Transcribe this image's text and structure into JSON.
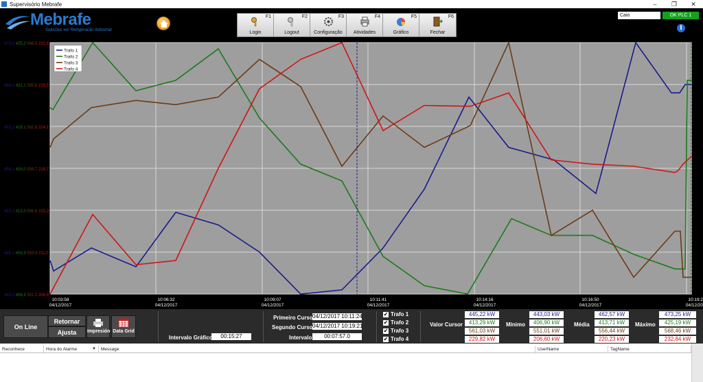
{
  "window": {
    "title": "Supervisório Mebrafe",
    "controls": [
      "–",
      "❐",
      "✕"
    ]
  },
  "logo": {
    "name": "Mebrafe",
    "tagline": "Soluções em Refrigeração Industrial"
  },
  "toolbar": [
    {
      "key": "F1",
      "label": "Login",
      "icon": "key-icon"
    },
    {
      "key": "F2",
      "label": "Logout",
      "icon": "key-out-icon"
    },
    {
      "key": "F3",
      "label": "Configuração",
      "icon": "gear-icon"
    },
    {
      "key": "F4",
      "label": "Atividades",
      "icon": "printer-list-icon"
    },
    {
      "key": "F5",
      "label": "Gráfico",
      "icon": "chart-icon"
    },
    {
      "key": "F6",
      "label": "Fechar",
      "icon": "exit-icon"
    }
  ],
  "user": "Caio",
  "plc_status": "OK PLC 1",
  "colors": {
    "trafo1": "#1a1a8c",
    "trafo2": "#1b7a1b",
    "trafo3": "#6b3a14",
    "trafo4": "#d01414",
    "plot_bg": "#9e9e9e",
    "plc_ok": "#14a21e"
  },
  "chart_data": {
    "type": "line",
    "y_axis_labels": [
      {
        "t1": "473,2",
        "t2": "425,2",
        "t3": "568,5",
        "t4": "232,8"
      },
      {
        "t1": "468,2",
        "t2": "422,1",
        "t3": "565,6",
        "t4": "228,5"
      },
      {
        "t1": "463,2",
        "t2": "419,1",
        "t3": "562,6",
        "t4": "224,1"
      },
      {
        "t1": "458,1",
        "t2": "416,0",
        "t3": "559,7",
        "t4": "219,7"
      },
      {
        "t1": "453,1",
        "t2": "413,0",
        "t3": "556,8",
        "t4": "215,3"
      },
      {
        "t1": "448,1",
        "t2": "409,9",
        "t3": "553,9",
        "t4": "211,0"
      },
      {
        "t1": "443,0",
        "t2": "406,9",
        "t3": "551,0",
        "t4": "206,6"
      }
    ],
    "x_ticks": [
      {
        "time": "10:03:58",
        "date": "04/12/2017",
        "x": 0
      },
      {
        "time": "10:06:32",
        "date": "04/12/2017",
        "x": 154
      },
      {
        "time": "10:09:07",
        "date": "04/12/2017",
        "x": 309
      },
      {
        "time": "10:11:41",
        "date": "04/12/2017",
        "x": 463
      },
      {
        "time": "10:14:16",
        "date": "04/12/2017",
        "x": 618
      },
      {
        "time": "10:16:50",
        "date": "04/12/2017",
        "x": 772
      },
      {
        "time": "10:19:25",
        "date": "04/12/2017",
        "x": 927
      }
    ],
    "x_range": [
      0,
      935
    ],
    "y_range": [
      0,
      6
    ],
    "grid": true,
    "legend_placement": "top-left",
    "cursor_x": 447,
    "series": [
      {
        "name": "Trafo 1",
        "color": "#1a1a8c",
        "points": [
          [
            0,
            5.2
          ],
          [
            5,
            5.45
          ],
          [
            60,
            4.9
          ],
          [
            125,
            5.35
          ],
          [
            183,
            4.05
          ],
          [
            245,
            4.35
          ],
          [
            305,
            5.0
          ],
          [
            365,
            6.0
          ],
          [
            425,
            5.9
          ],
          [
            485,
            4.9
          ],
          [
            545,
            3.5
          ],
          [
            610,
            1.3
          ],
          [
            668,
            2.5
          ],
          [
            734,
            2.8
          ],
          [
            795,
            3.6
          ],
          [
            853,
            0.0
          ],
          [
            905,
            1.2
          ],
          [
            917,
            1.2
          ],
          [
            925,
            1.0
          ],
          [
            935,
            1.0
          ]
        ]
      },
      {
        "name": "Trafo 2",
        "color": "#1b7a1b",
        "points": [
          [
            0,
            1.55
          ],
          [
            4,
            1.6
          ],
          [
            62,
            0.0
          ],
          [
            125,
            1.15
          ],
          [
            183,
            0.9
          ],
          [
            245,
            0.15
          ],
          [
            305,
            1.8
          ],
          [
            365,
            2.9
          ],
          [
            425,
            3.3
          ],
          [
            485,
            5.1
          ],
          [
            545,
            5.8
          ],
          [
            608,
            6.0
          ],
          [
            672,
            4.2
          ],
          [
            730,
            4.6
          ],
          [
            790,
            4.6
          ],
          [
            850,
            5.05
          ],
          [
            910,
            5.4
          ],
          [
            925,
            5.4
          ],
          [
            928,
            0.9
          ],
          [
            935,
            0.9
          ]
        ]
      },
      {
        "name": "Trafo 3",
        "color": "#6b3a14",
        "points": [
          [
            0,
            2.5
          ],
          [
            5,
            2.3
          ],
          [
            60,
            1.55
          ],
          [
            125,
            1.38
          ],
          [
            183,
            1.48
          ],
          [
            245,
            1.3
          ],
          [
            305,
            0.4
          ],
          [
            365,
            1.05
          ],
          [
            425,
            2.95
          ],
          [
            485,
            1.75
          ],
          [
            545,
            2.5
          ],
          [
            612,
            1.98
          ],
          [
            668,
            0.0
          ],
          [
            730,
            4.6
          ],
          [
            790,
            4.0
          ],
          [
            850,
            5.6
          ],
          [
            910,
            4.5
          ],
          [
            918,
            4.5
          ],
          [
            922,
            5.6
          ],
          [
            935,
            5.6
          ]
        ]
      },
      {
        "name": "Trafo 4",
        "color": "#d01414",
        "points": [
          [
            0,
            6.0
          ],
          [
            62,
            4.1
          ],
          [
            125,
            5.3
          ],
          [
            183,
            5.2
          ],
          [
            245,
            3.0
          ],
          [
            305,
            1.1
          ],
          [
            365,
            0.4
          ],
          [
            425,
            0.0
          ],
          [
            485,
            2.1
          ],
          [
            545,
            1.5
          ],
          [
            612,
            1.52
          ],
          [
            668,
            1.2
          ],
          [
            730,
            2.8
          ],
          [
            790,
            2.9
          ],
          [
            850,
            2.95
          ],
          [
            910,
            3.1
          ],
          [
            915,
            3.05
          ],
          [
            922,
            2.9
          ],
          [
            935,
            2.7
          ]
        ]
      }
    ]
  },
  "panel": {
    "online_label": "On Line",
    "retornar_label": "Retornar",
    "ajusta_label": "Ajusta",
    "print_label": "Impresión",
    "grid_label": "Data Grid",
    "intervalo_grafico_label": "Intervalo Gráfico",
    "intervalo_grafico_value": "00:15:27",
    "primeiro_cursor_label": "Primeiro Cursor",
    "primeiro_cursor_value": "04/12/2017 10:11:24",
    "segundo_cursor_label": "Segundo Cursor",
    "segundo_cursor_value": "04/12/2017 10:19:21",
    "intervalo_label": "Intervalo",
    "intervalo_value": "00:07:57.0",
    "checks": [
      "Trafo 1",
      "Trafo 2",
      "Trafo 3",
      "Trafo 4"
    ],
    "valor_cursor_label": "Valor Cursor",
    "minimo_label": "Mínimo",
    "media_label": "Média",
    "maximo_label": "Máximo",
    "valor_cursor": [
      "445,22 kW",
      "413,29 kW",
      "561,03 kW",
      "229,82 kW"
    ],
    "minimo": [
      "443,03 kW",
      "406,90 kW",
      "551,01 kW",
      "206,60 kW"
    ],
    "media": [
      "462,57 kW",
      "413,71 kW",
      "556,44 kW",
      "220,23 kW"
    ],
    "maximo": [
      "473,25 kW",
      "425,19 kW",
      "568,46 kW",
      "232,84 kW"
    ]
  },
  "alarm_table": {
    "columns": [
      "Reconhece",
      "Hora do Alarme",
      "Message",
      "UserName",
      "TagName"
    ]
  }
}
